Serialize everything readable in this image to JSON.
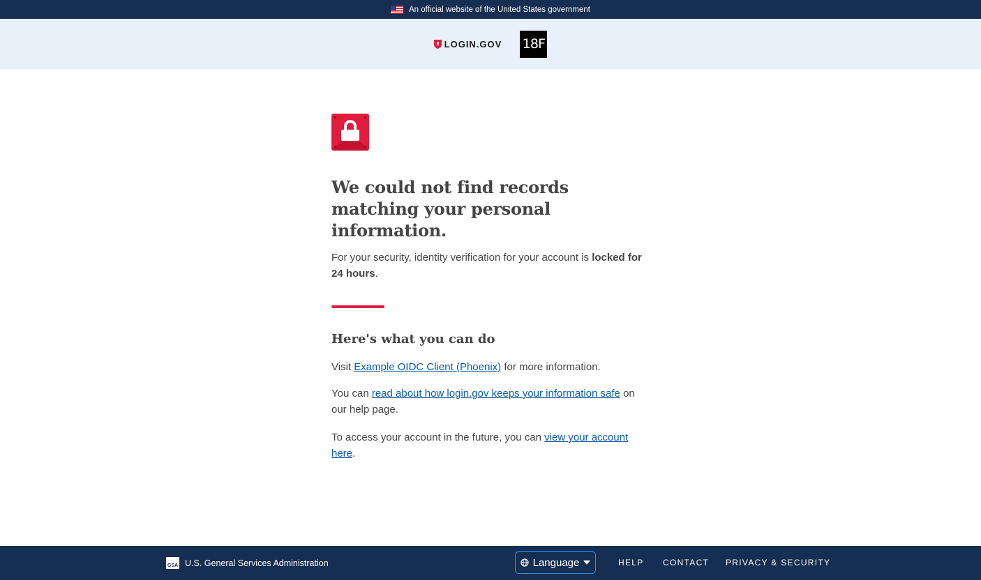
{
  "gov_banner": {
    "text": "An official website of the United States government"
  },
  "header": {
    "logo_text": "LOGIN.GOV",
    "partner_logo_text": "18F"
  },
  "main": {
    "icon": "lock-icon",
    "title": "We could not find records matching your personal information.",
    "lead_prefix": "For your security, identity verification for your account is ",
    "lead_bold": "locked for 24 hours",
    "lead_suffix": ".",
    "subheading": "Here's what you can do",
    "p1_prefix": "Visit ",
    "p1_link": "Example OIDC Client (Phoenix)",
    "p1_suffix": " for more information.",
    "p2_prefix": "You can ",
    "p2_link": "read about how login.gov keeps your information safe",
    "p2_suffix": " on our help page.",
    "p3_prefix": "To access your account in the future, you can ",
    "p3_link": "view your account here",
    "p3_suffix": "."
  },
  "footer": {
    "agency_icon_text": "GSA",
    "agency": "U.S. General Services Administration",
    "language_label": "Language",
    "links": [
      "HELP",
      "CONTACT",
      "PRIVACY & SECURITY"
    ]
  },
  "colors": {
    "navy": "#162e51",
    "header_bg": "#e8f0f9",
    "accent_red": "#e21c3d",
    "link": "#0d5ca8"
  }
}
